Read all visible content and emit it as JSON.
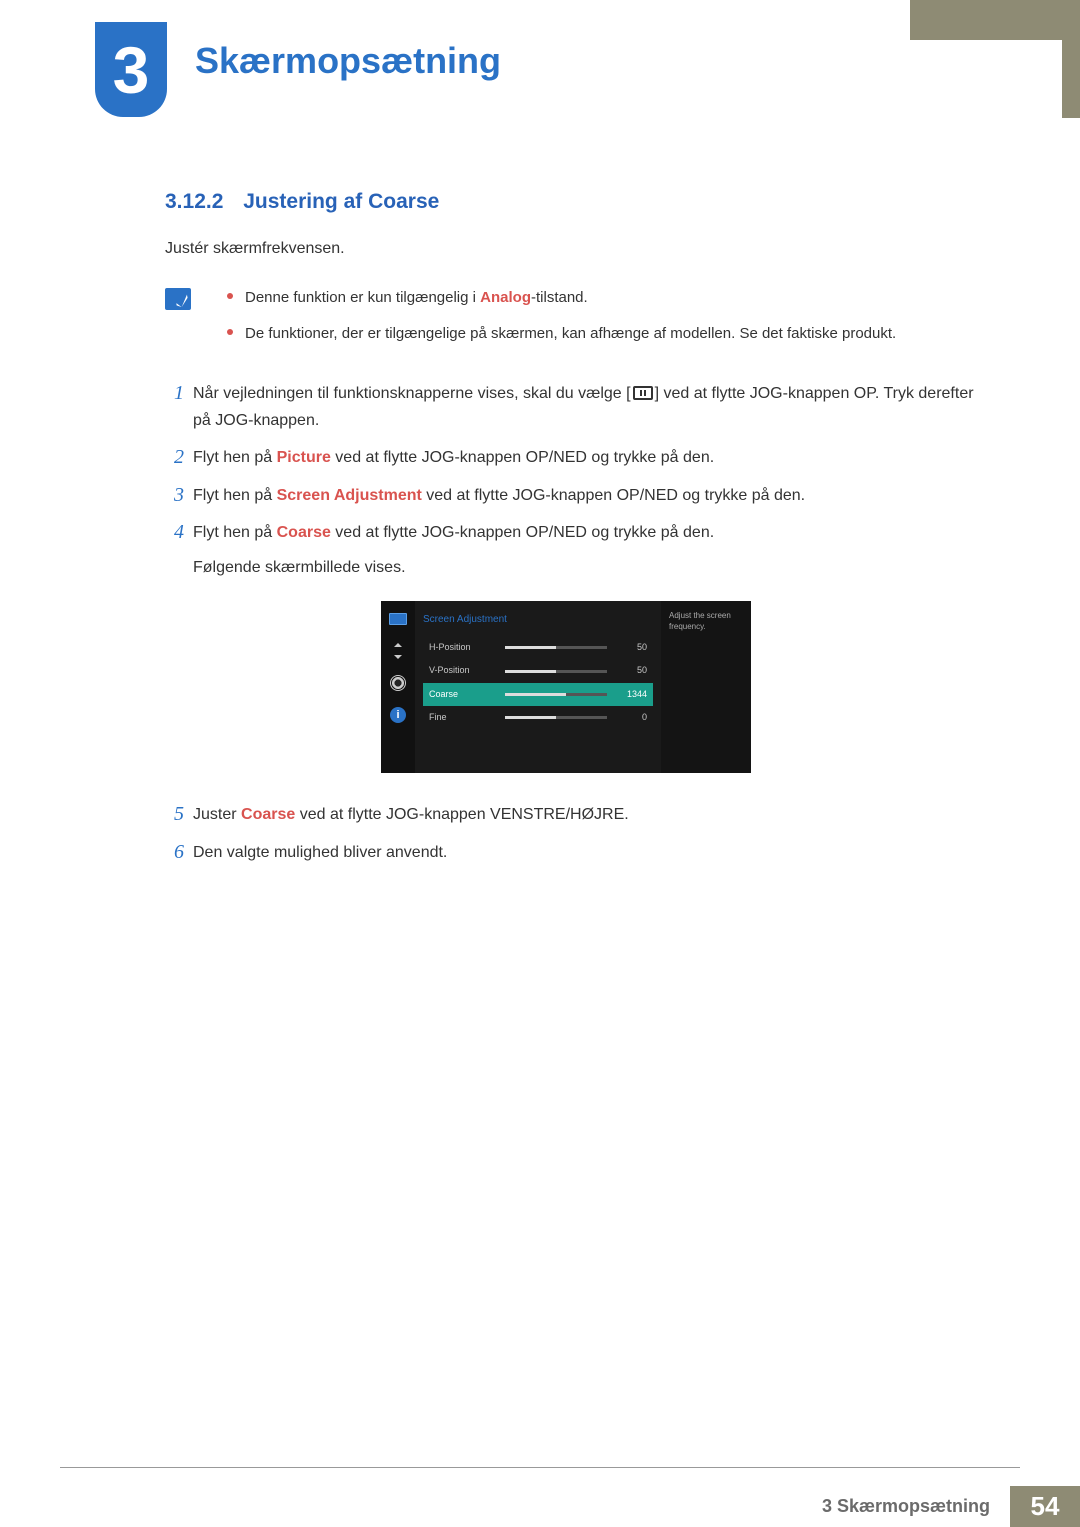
{
  "chapter": {
    "number": "3",
    "title": "Skærmopsætning"
  },
  "section": {
    "number": "3.12.2",
    "title": "Justering af Coarse"
  },
  "intro": "Justér skærmfrekvensen.",
  "notes": {
    "n1a": "Denne funktion er kun tilgængelig i ",
    "n1b": "Analog",
    "n1c": "-tilstand.",
    "n2": "De funktioner, der er tilgængelige på skærmen, kan afhænge af modellen. Se det faktiske produkt."
  },
  "steps": {
    "s1a": "Når vejledningen til funktionsknapperne vises, skal du vælge [",
    "s1b": "] ved at flytte JOG-knappen OP. Tryk derefter på JOG-knappen.",
    "s2a": "Flyt hen på ",
    "s2b": "Picture",
    "s2c": " ved at flytte JOG-knappen OP/NED og trykke på den.",
    "s3a": "Flyt hen på ",
    "s3b": "Screen Adjustment",
    "s3c": " ved at flytte JOG-knappen OP/NED og trykke på den.",
    "s4a": "Flyt hen på ",
    "s4b": "Coarse",
    "s4c": " ved at flytte JOG-knappen OP/NED og trykke på den.",
    "s4d": "Følgende skærmbillede vises.",
    "s5a": "Juster ",
    "s5b": "Coarse",
    "s5c": " ved at flytte JOG-knappen VENSTRE/HØJRE.",
    "s6": "Den valgte mulighed bliver anvendt."
  },
  "osd": {
    "title": "Screen Adjustment",
    "help": "Adjust the screen frequency.",
    "rows": [
      {
        "label": "H-Position",
        "value": "50",
        "pct": 50,
        "sel": false
      },
      {
        "label": "V-Position",
        "value": "50",
        "pct": 50,
        "sel": false
      },
      {
        "label": "Coarse",
        "value": "1344",
        "pct": 60,
        "sel": true
      },
      {
        "label": "Fine",
        "value": "0",
        "pct": 50,
        "sel": false
      }
    ],
    "infoGlyph": "i"
  },
  "footer": {
    "label": "3 Skærmopsætning",
    "page": "54"
  }
}
